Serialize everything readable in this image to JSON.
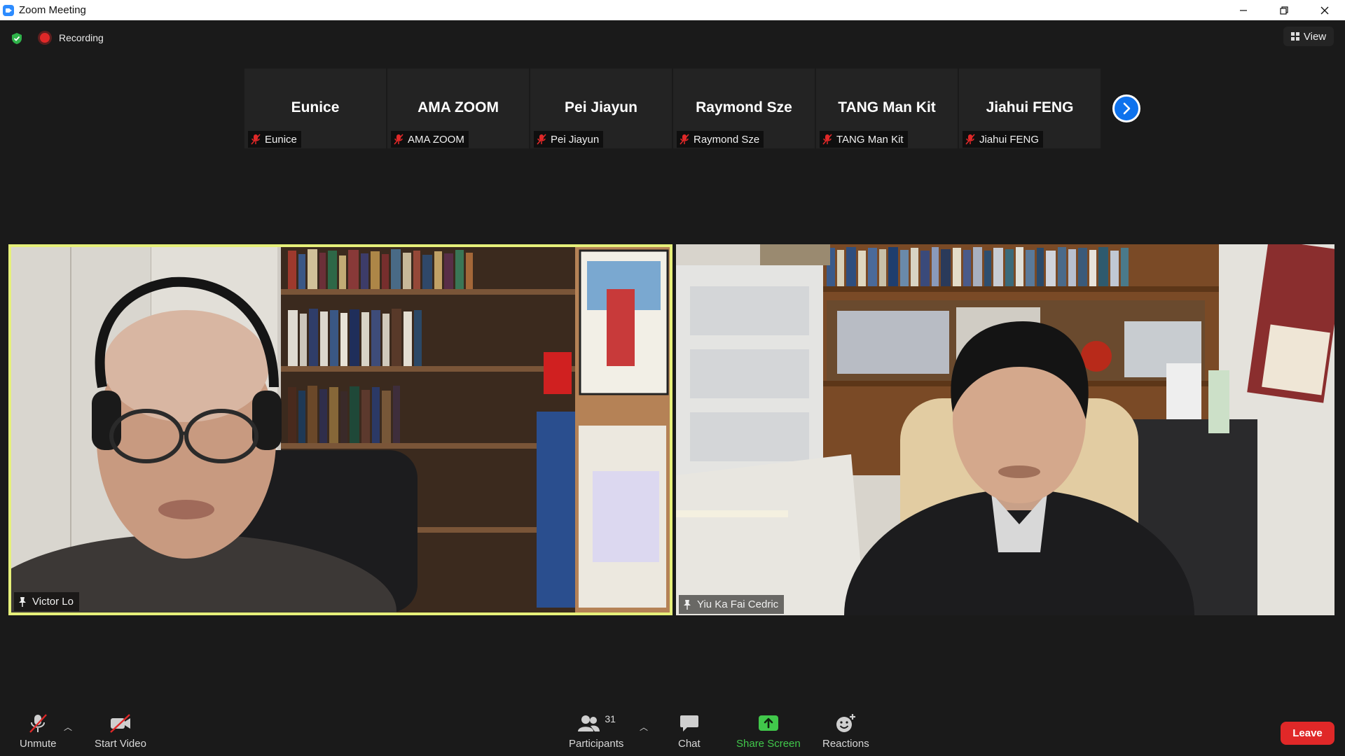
{
  "window": {
    "title": "Zoom Meeting"
  },
  "status": {
    "recording_label": "Recording"
  },
  "view": {
    "label": "View"
  },
  "thumbnails": [
    {
      "display_name": "Eunice",
      "tag_name": "Eunice"
    },
    {
      "display_name": "AMA ZOOM",
      "tag_name": "AMA ZOOM"
    },
    {
      "display_name": "Pei Jiayun",
      "tag_name": "Pei Jiayun"
    },
    {
      "display_name": "Raymond Sze",
      "tag_name": "Raymond Sze"
    },
    {
      "display_name": "TANG Man Kit",
      "tag_name": "TANG Man Kit"
    },
    {
      "display_name": "Jiahui FENG",
      "tag_name": "Jiahui FENG"
    }
  ],
  "videos": [
    {
      "name": "Victor Lo",
      "active_speaker": true
    },
    {
      "name": "Yiu Ka Fai Cedric",
      "active_speaker": false
    }
  ],
  "toolbar": {
    "unmute_label": "Unmute",
    "start_video_label": "Start Video",
    "participants_label": "Participants",
    "participants_count": "31",
    "chat_label": "Chat",
    "share_screen_label": "Share Screen",
    "reactions_label": "Reactions",
    "leave_label": "Leave"
  },
  "colors": {
    "background": "#1a1a1a",
    "active_speaker_border": "#e6f07a",
    "share_green": "#41c84b",
    "leave_red": "#e02828",
    "accent_blue": "#0e72ed",
    "muted_red": "#e02828"
  },
  "icons": {
    "shield": "shield-check-icon",
    "recording": "recording-dot-icon",
    "view": "grid-view-icon",
    "mic_muted": "microphone-muted-icon",
    "video_off": "video-off-icon",
    "participants": "participants-icon",
    "chat": "chat-bubble-icon",
    "share": "share-screen-icon",
    "reactions": "emoji-add-icon",
    "pin": "pin-icon",
    "next": "chevron-right-icon"
  }
}
